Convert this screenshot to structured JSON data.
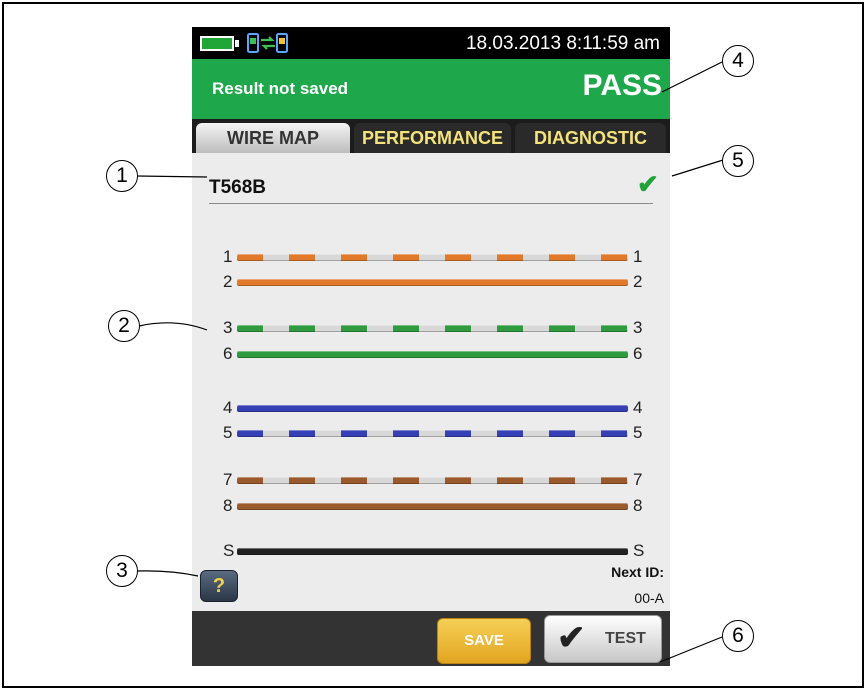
{
  "status_bar": {
    "datetime": "18.03.2013 8:11:59 am",
    "battery_icon": "battery-icon",
    "link_icon": "remote-link-icon"
  },
  "result_bar": {
    "message": "Result not saved",
    "status": "PASS",
    "color": "#1ea84b"
  },
  "tabs": [
    {
      "label": "WIRE MAP",
      "selected": true
    },
    {
      "label": "PERFORMANCE",
      "selected": false
    },
    {
      "label": "DIAGNOSTIC",
      "selected": false
    }
  ],
  "wiremap": {
    "standard": "T568B",
    "result_icon": "checkmark-icon",
    "wires": [
      {
        "left": "1",
        "right": "1",
        "color": "#e07a2a",
        "striped": true
      },
      {
        "left": "2",
        "right": "2",
        "color": "#e07a2a",
        "striped": false
      },
      {
        "left": "3",
        "right": "3",
        "color": "#2f9a3e",
        "striped": true
      },
      {
        "left": "6",
        "right": "6",
        "color": "#2f9a3e",
        "striped": false
      },
      {
        "left": "4",
        "right": "4",
        "color": "#3540b5",
        "striped": false
      },
      {
        "left": "5",
        "right": "5",
        "color": "#3540b5",
        "striped": true
      },
      {
        "left": "7",
        "right": "7",
        "color": "#9a5a2c",
        "striped": true
      },
      {
        "left": "8",
        "right": "8",
        "color": "#9a5a2c",
        "striped": false
      },
      {
        "left": "S",
        "right": "S",
        "color": "#222222",
        "striped": false
      }
    ]
  },
  "help_button": {
    "label": "?"
  },
  "next_id": {
    "label": "Next ID:",
    "value": "00-A"
  },
  "buttons": {
    "save": "SAVE",
    "test": "TEST"
  },
  "callouts": [
    "1",
    "2",
    "3",
    "4",
    "5",
    "6"
  ]
}
